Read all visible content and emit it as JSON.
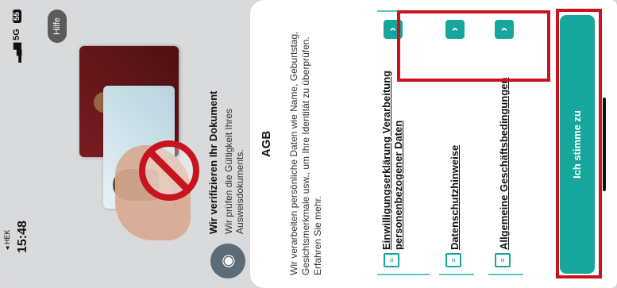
{
  "status_bar": {
    "time": "15:48",
    "back_label": "◂ HEK",
    "network": "5G",
    "battery": "55"
  },
  "help_button": "Hilfe",
  "verify": {
    "title": "Wir verifizieren Ihr Dokument",
    "text": "Wir prüfen die Gültigkeit Ihres Ausweisdokuments."
  },
  "sheet": {
    "title": "AGB",
    "intro": "Wir verarbeiten persönliche Daten wie Name, Geburtstag, Gesichtsmerkmale usw., um Ihre Identität zu überprüfen. Erfahren Sie mehr.",
    "items": [
      {
        "label": "Einwilligungserklärung Verarbeitung personenbezogener Daten"
      },
      {
        "label": "Datenschutzhinweise"
      },
      {
        "label": "Allgemeine Geschäftsbedingungen"
      }
    ],
    "agree_button": "Ich stimme zu"
  },
  "icons": {
    "camera": "camera-icon",
    "document": "document-icon",
    "chevron": "chevron-right-icon",
    "prohibited": "prohibited-icon"
  },
  "colors": {
    "accent": "#16a69b",
    "highlight": "#c8141e"
  }
}
